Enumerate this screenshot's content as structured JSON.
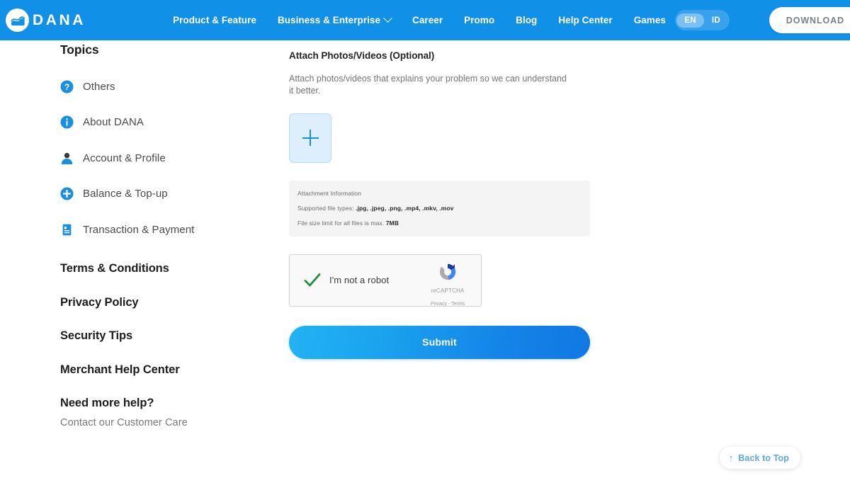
{
  "header": {
    "logo_text": "DANA",
    "logo_icon": "dana-wave-logo-icon",
    "nav": [
      {
        "label": "Product & Feature",
        "has_caret": false
      },
      {
        "label": "Business & Enterprise",
        "has_caret": true
      },
      {
        "label": "Career",
        "has_caret": false
      },
      {
        "label": "Promo",
        "has_caret": false
      },
      {
        "label": "Blog",
        "has_caret": false
      },
      {
        "label": "Help Center",
        "has_caret": false
      },
      {
        "label": "Games",
        "has_caret": false
      }
    ],
    "lang": {
      "options": [
        "EN",
        "ID"
      ],
      "selected": "EN"
    },
    "download_label": "DOWNLOAD",
    "background_color": "#1190e8"
  },
  "sidebar": {
    "title": "Topics",
    "topics": [
      {
        "label": "Others",
        "icon": "question-circle-icon"
      },
      {
        "label": "About DANA",
        "icon": "info-circle-icon"
      },
      {
        "label": "Account & Profile",
        "icon": "person-icon"
      },
      {
        "label": "Balance & Top-up",
        "icon": "plus-circle-icon"
      },
      {
        "label": "Transaction & Payment",
        "icon": "document-icon"
      }
    ],
    "links": [
      "Terms & Conditions",
      "Privacy Policy",
      "Security Tips",
      "Merchant Help Center"
    ],
    "need_help": {
      "title": "Need more help?",
      "subtitle": "Contact our Customer Care"
    }
  },
  "main": {
    "section_title": "Attach Photos/Videos (Optional)",
    "section_desc": "Attach photos/videos that explains your problem so we can understand it better.",
    "upload": {
      "icon": "plus-icon"
    },
    "attachment_info": {
      "title": "Attachment Information",
      "supported_label": "Supported file types:",
      "supported_value": ".jpg, .jpeg, .png, .mp4, .mkv, .mov",
      "size_label": "File size limit for all files is max.",
      "size_value": "7MB"
    },
    "recaptcha": {
      "label": "I'm not a robot",
      "checked": true,
      "brand_name": "reCAPTCHA",
      "terms": "Privacy - Terms"
    },
    "submit_label": "Submit"
  },
  "back_to_top": {
    "label": "Back to Top",
    "arrow": "arrow-up-icon"
  },
  "colors": {
    "brand_blue": "#1190e8",
    "accent_cyan": "#22b3f2",
    "text_dark": "#1d1d1f",
    "text_muted": "#77787c",
    "info_bg": "#f4f4f4"
  }
}
